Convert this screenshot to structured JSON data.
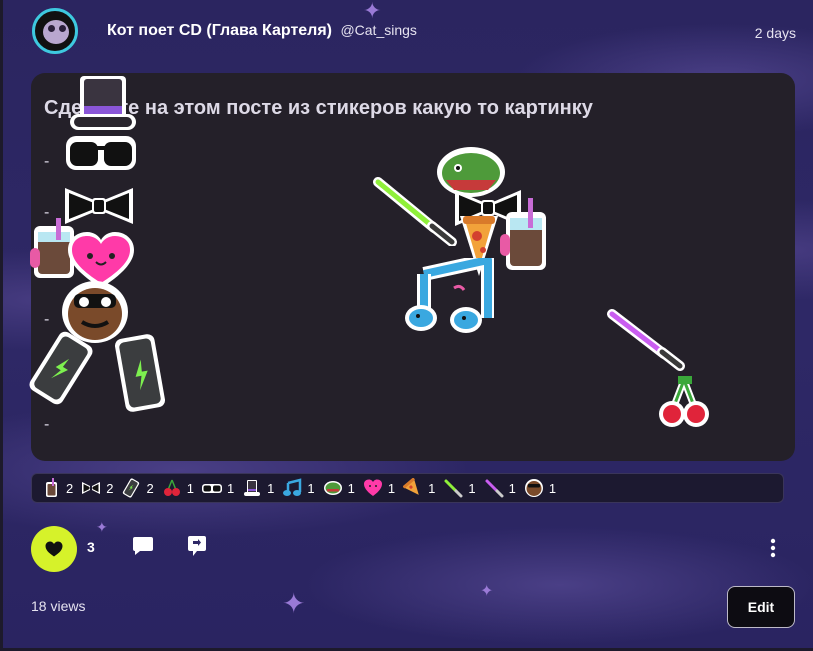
{
  "post": {
    "author_name": "Кот поет CD (Глава Картеля)",
    "author_handle": "@Cat_sings",
    "time_ago": "2 days",
    "text": "Сделайте на этом посте из стикеров какую то картинку",
    "lines": [
      "-",
      "-",
      "-",
      "-",
      "-"
    ]
  },
  "reactions": [
    {
      "icon": "iced-coffee-icon",
      "count": "2"
    },
    {
      "icon": "bow-tie-icon",
      "count": "2"
    },
    {
      "icon": "phone-icon",
      "count": "2"
    },
    {
      "icon": "cherries-icon",
      "count": "1"
    },
    {
      "icon": "sunglasses-icon",
      "count": "1"
    },
    {
      "icon": "top-hat-icon",
      "count": "1"
    },
    {
      "icon": "music-notes-icon",
      "count": "1"
    },
    {
      "icon": "dino-icon",
      "count": "1"
    },
    {
      "icon": "heart-face-icon",
      "count": "1"
    },
    {
      "icon": "pizza-icon",
      "count": "1"
    },
    {
      "icon": "green-lightsaber-icon",
      "count": "1"
    },
    {
      "icon": "purple-lightsaber-icon",
      "count": "1"
    },
    {
      "icon": "face-sticker-icon",
      "count": "1"
    }
  ],
  "actions": {
    "like_count": "3",
    "views": "18 views",
    "edit_label": "Edit"
  },
  "colors": {
    "accent": "#d6f22a",
    "card_bg": "#242029",
    "page_bg": "#2e2866"
  }
}
